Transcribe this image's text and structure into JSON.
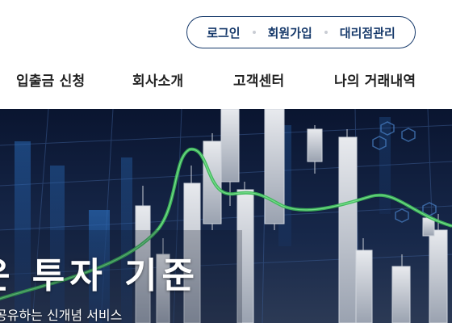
{
  "header": {
    "auth_links": [
      "로그인",
      "회원가입",
      "대리점관리"
    ]
  },
  "nav": {
    "items": [
      "입출금 신청",
      "회사소개",
      "고객센터",
      "나의 거래내역"
    ]
  },
  "hero": {
    "title": "운 투자 기준",
    "subtitle": "공유하는 신개념 서비스"
  },
  "colors": {
    "brand_navy": "#173a6b",
    "hero_bg": "#0d1a36",
    "trend_green": "#3db85a"
  }
}
